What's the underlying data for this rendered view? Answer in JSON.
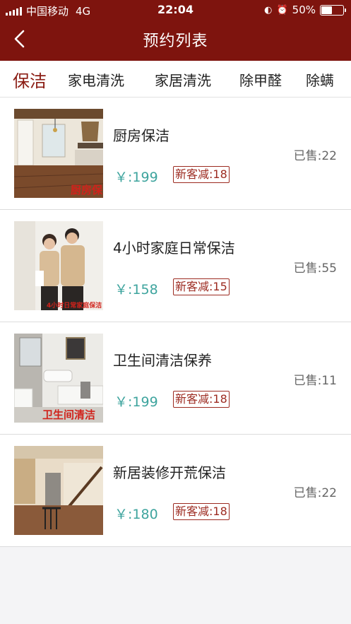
{
  "status_bar": {
    "carrier": "中国移动",
    "network": "4G",
    "time": "22:04",
    "battery": "50%",
    "battery_level": 0.5
  },
  "nav": {
    "title": "预约列表"
  },
  "tabs": [
    {
      "label": "保洁",
      "active": true
    },
    {
      "label": "家电清洗",
      "active": false
    },
    {
      "label": "家居清洗",
      "active": false
    },
    {
      "label": "除甲醛",
      "active": false
    },
    {
      "label": "除螨",
      "active": false
    }
  ],
  "services": [
    {
      "title": "厨房保洁",
      "price": "￥:199",
      "promo": "新客减:18",
      "sold": "已售:22",
      "image_caption": "厨房保"
    },
    {
      "title": "4小时家庭日常保洁",
      "price": "￥:158",
      "promo": "新客减:15",
      "sold": "已售:55",
      "image_caption": "4小时日常家庭保洁"
    },
    {
      "title": "卫生间清洁保养",
      "price": "￥:199",
      "promo": "新客减:18",
      "sold": "已售:11",
      "image_caption": "卫生间清洁"
    },
    {
      "title": "新居装修开荒保洁",
      "price": "￥:180",
      "promo": "新客减:18",
      "sold": "已售:22",
      "image_caption": ""
    }
  ],
  "colors": {
    "header": "#7e140e",
    "accent": "#8a1b12",
    "price": "#3ea49e"
  }
}
